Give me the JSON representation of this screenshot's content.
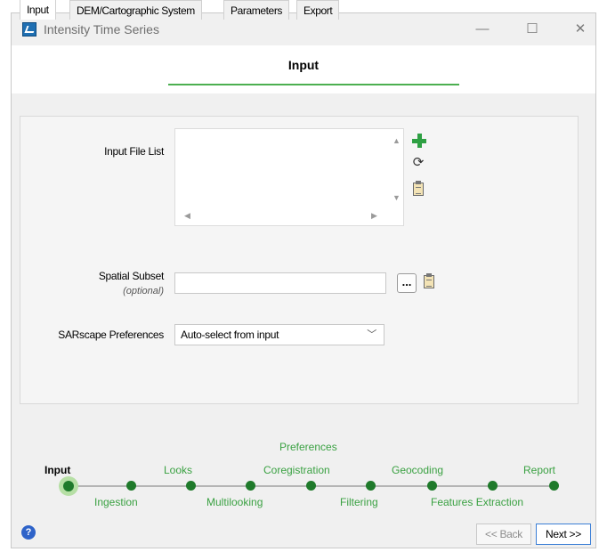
{
  "window": {
    "title": "Intensity Time Series",
    "minimize": "—",
    "maximize": "☐",
    "close": "✕"
  },
  "header": {
    "title": "Input"
  },
  "tabs": [
    {
      "label": "Input",
      "active": true
    },
    {
      "label": "DEM/Cartographic System",
      "active": false
    },
    {
      "label": "Parameters",
      "active": false
    },
    {
      "label": "Export",
      "active": false
    }
  ],
  "form": {
    "input_file_list_label": "Input File List",
    "spatial_subset_label": "Spatial Subset",
    "spatial_subset_hint": "(optional)",
    "spatial_subset_value": "",
    "browse_label": "...",
    "preferences_label": "SARscape Preferences",
    "preferences_value": "Auto-select from input"
  },
  "icons": {
    "add": "add-icon",
    "refresh": "refresh-icon",
    "paste": "clipboard-icon",
    "help": "help-icon"
  },
  "workflow": {
    "top_labels": [
      "Input",
      "Looks",
      "Coregistration",
      "Geocoding",
      "Report"
    ],
    "bottom_labels": [
      "Ingestion",
      "Multilooking",
      "Filtering",
      "Features Extraction"
    ],
    "above_label": "Preferences",
    "current_step": "Input"
  },
  "footer": {
    "back_label": "<< Back",
    "next_label": "Next >>",
    "help_glyph": "?"
  },
  "colors": {
    "accent_green": "#4caf50",
    "step_dot": "#1f7a2b",
    "step_label": "#3aa142",
    "help_blue": "#2e63c9"
  }
}
